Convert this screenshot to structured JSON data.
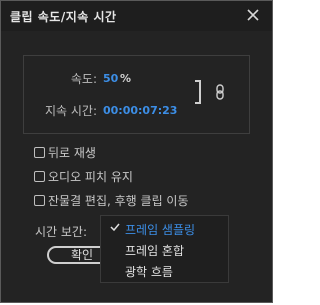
{
  "dialog": {
    "title": "클립 속도/지속 시간",
    "close_glyph": "✕"
  },
  "speed": {
    "label": "속도:",
    "value": "50",
    "unit": "%"
  },
  "duration": {
    "label": "지속 시간:",
    "value": "00:00:07:23"
  },
  "link_icon": "link-chain-icon",
  "options": [
    {
      "label": "뒤로 재생",
      "checked": false
    },
    {
      "label": "오디오 피치 유지",
      "checked": false
    },
    {
      "label": "잔물결 편집, 후행 클립 이동",
      "checked": false
    }
  ],
  "interpolation": {
    "label": "시간 보간:",
    "selected": "프레임 샘플링",
    "menu_items": [
      "프레임 샘플링",
      "프레임 혼합",
      "광학 흐름"
    ]
  },
  "confirm_button": {
    "label": "확인"
  },
  "colors": {
    "accent": "#3c8ee6",
    "background": "#232323",
    "text": "#c8c8c8"
  }
}
